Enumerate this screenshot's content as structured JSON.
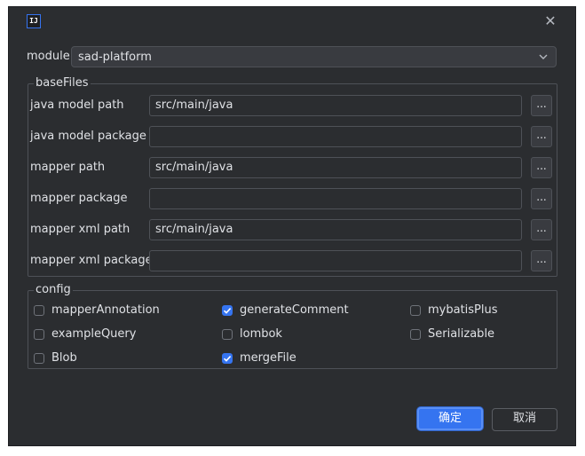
{
  "titlebar": {
    "icon_text": "IJ",
    "close": "✕"
  },
  "module": {
    "label": "module",
    "value": "sad-platform"
  },
  "baseFiles": {
    "legend": "baseFiles",
    "rows": [
      {
        "label": "java model path",
        "value": "src/main/java",
        "browse": "..."
      },
      {
        "label": "java model package",
        "value": "",
        "browse": "..."
      },
      {
        "label": "mapper path",
        "value": "src/main/java",
        "browse": "..."
      },
      {
        "label": "mapper package",
        "value": "",
        "browse": "..."
      },
      {
        "label": "mapper xml path",
        "value": "src/main/java",
        "browse": "..."
      },
      {
        "label": "mapper xml package",
        "value": "",
        "browse": "..."
      }
    ]
  },
  "config": {
    "legend": "config",
    "options": [
      {
        "label": "mapperAnnotation",
        "checked": false
      },
      {
        "label": "generateComment",
        "checked": true
      },
      {
        "label": "mybatisPlus",
        "checked": false
      },
      {
        "label": "exampleQuery",
        "checked": false
      },
      {
        "label": "lombok",
        "checked": false
      },
      {
        "label": "Serializable",
        "checked": false
      },
      {
        "label": "Blob",
        "checked": false
      },
      {
        "label": "mergeFile",
        "checked": true
      }
    ]
  },
  "buttons": {
    "ok": "确定",
    "cancel": "取消"
  },
  "colors": {
    "background": "#2b2d30",
    "accent": "#3574f0",
    "border": "#4e5157",
    "text": "#dfe1e5"
  }
}
